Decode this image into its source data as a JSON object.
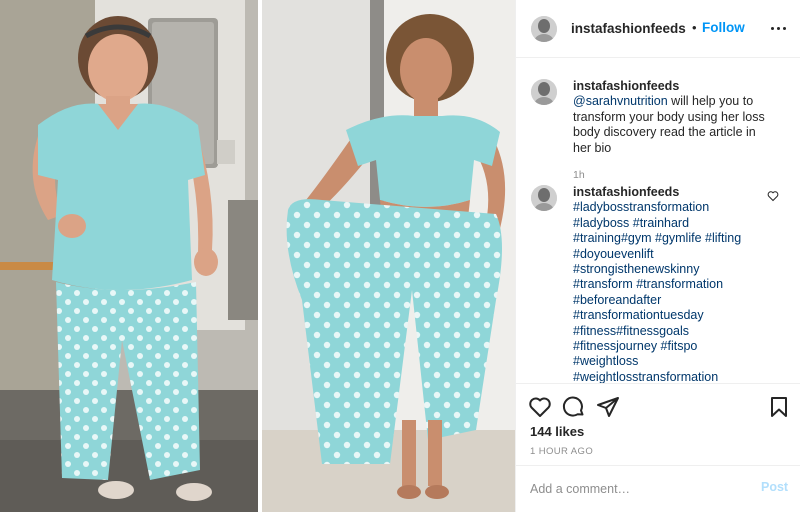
{
  "header": {
    "username": "instafashionfeeds",
    "separator": "•",
    "follow_label": "Follow"
  },
  "photo": {
    "left": {
      "name": "before-photo",
      "description_colors": {
        "outfit": "#8fd6d8",
        "wall": "#c9c7c1"
      }
    },
    "right": {
      "name": "after-photo",
      "description_colors": {
        "outfit": "#8fd6d8",
        "wall": "#e9e7e3"
      }
    }
  },
  "caption": {
    "username": "instafashionfeeds",
    "mention": "@sarahvnutrition",
    "text": "will help you to transform your body using her loss body discovery read the article in her bio",
    "time": "1h"
  },
  "hashtag_comment": {
    "username": "instafashionfeeds",
    "tags": [
      "#ladybosstransformation",
      "#ladyboss #trainhard",
      "#training#gym #gymlife #lifting",
      "#doyouevenlift",
      "#strongisthenewskinny",
      "#transform #transformation",
      "#beforeandafter",
      "#transformationtuesday",
      "#fitness#fitnessgoals",
      "#fitnessjourney #fitspo",
      "#weightloss",
      "#weightlosstransformation"
    ]
  },
  "actions": {
    "likes": "144 likes",
    "time_ago": "1 HOUR AGO"
  },
  "add_comment": {
    "placeholder": "Add a comment…",
    "post_label": "Post"
  },
  "colors": {
    "link": "#0095f6",
    "hashtag": "#00376b",
    "muted": "#8e8e8e",
    "post_disabled": "#b2dffc",
    "pajama": "#8fd6d8"
  }
}
